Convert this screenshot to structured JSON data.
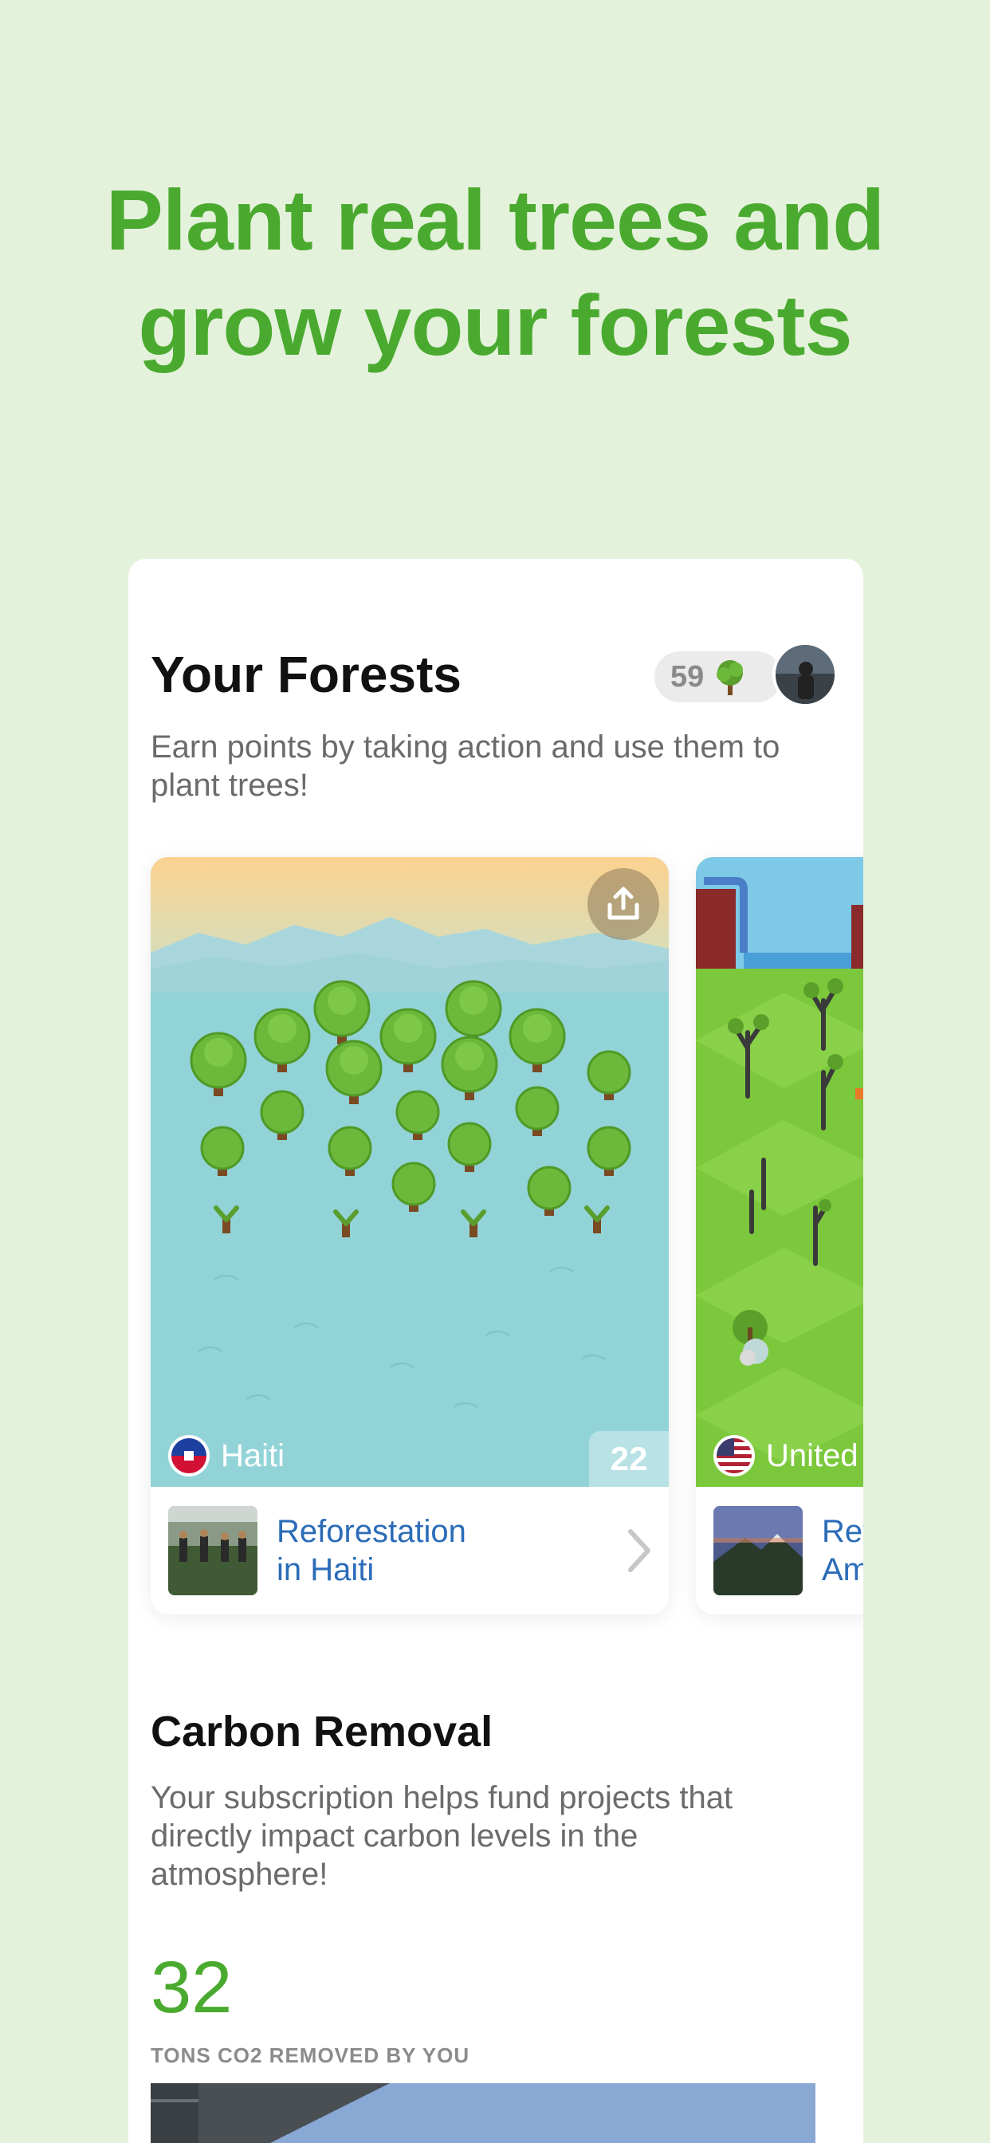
{
  "headline": {
    "line1": "Plant real trees and",
    "line2": "grow your forests"
  },
  "forests": {
    "title": "Your Forests",
    "subtitle": "Earn points by taking action and use them to plant trees!",
    "points": "59",
    "points_icon": "tree-icon",
    "cards": [
      {
        "location": "Haiti",
        "count": "22",
        "project_line1": "Reforestation",
        "project_line2": "in Haiti"
      },
      {
        "location": "United",
        "project_line1": "Ref",
        "project_line2": "Am"
      }
    ]
  },
  "carbon": {
    "title": "Carbon Removal",
    "subtitle": "Your subscription helps fund projects that directly impact carbon levels in the atmosphere!",
    "amount": "32",
    "caption": "TONS CO2 REMOVED BY YOU"
  },
  "colors": {
    "background": "#e4f2dc",
    "accent_green": "#4aaa2f",
    "link_blue": "#2b6cb8"
  }
}
